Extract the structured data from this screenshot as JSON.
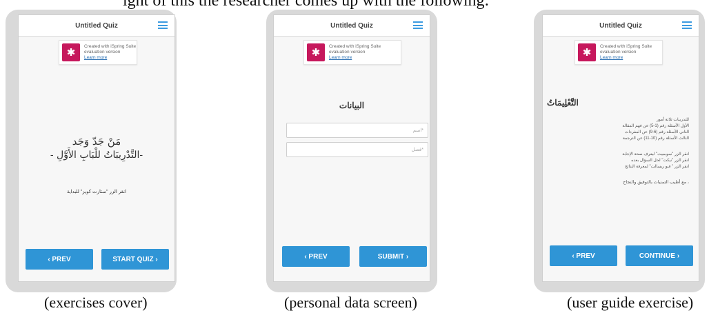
{
  "top_text": "ight of this the researcher comes up with the following:",
  "quiz_title": "Untitled Quiz",
  "ispring": {
    "line1": "Created with iSpring Suite",
    "line2": "evaluation version",
    "link": "Learn more"
  },
  "screen1": {
    "heading1": "مَنْ جَدّ وَجَد",
    "heading2": "-التَّدْرِيبَاتُ للْبَابِ الأَوَّلِ -",
    "instruction": "انقر الزر \"ستارت كويز\" للبداية",
    "prev": "‹ PREV",
    "next": "START QUIZ ›"
  },
  "screen2": {
    "heading": "البيانات",
    "field1_placeholder": "*اسم",
    "field2_placeholder": "*فصل",
    "prev": "‹ PREV",
    "next": "SUBMIT ›"
  },
  "screen3": {
    "heading": "التَّعْلِيمَاتُ",
    "lines_a": [
      "للتدريبات ثلاثة أمور",
      "الأول الأسئلة رقم (1-5) عن فهم المقالة",
      "الثاني الأسئلة رقم (6-9) عن المفردات",
      "الثالث الأسئلة رقم (10-11) عن الترجمة"
    ],
    "lines_b": [
      "انقر الزر \"سوبميت\" ليعرف صحة الإجابة",
      "انقر الزر \"نيكت\" لحل السؤال بعده",
      "انقر الزر \" فيو ريسالت\" لمعرفة النتائج"
    ],
    "closing": "، مع أطيب التمنيات بالتوفيق والنجاح",
    "prev": "‹ PREV",
    "next": "CONTINUE ›"
  },
  "captions": {
    "c1": "(exercises cover)",
    "c2": "(personal data screen)",
    "c3": "(user guide exercise)"
  }
}
